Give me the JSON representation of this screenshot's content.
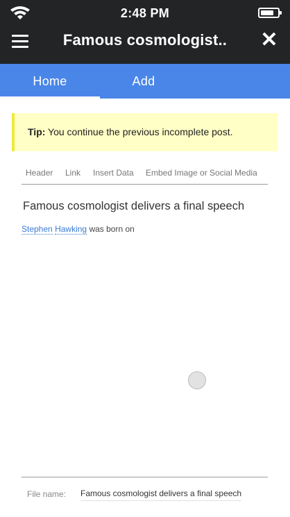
{
  "status_bar": {
    "time": "2:48 PM",
    "icons": [
      "wifi-icon",
      "battery-icon"
    ]
  },
  "app_bar": {
    "title": "Famous cosmologist..",
    "menu_icon": "hamburger-menu-icon",
    "close_icon": "close-icon"
  },
  "tabs": [
    {
      "label": "Home",
      "active": true
    },
    {
      "label": "Add",
      "active": false
    }
  ],
  "tip": {
    "label": "Tip:",
    "text": " You continue the previous incomplete post."
  },
  "editor_toolbar": {
    "items": [
      "Header",
      "Link",
      "Insert Data",
      "Embed Image or Social Media"
    ]
  },
  "post": {
    "headline": "Famous cosmologist delivers a final speech",
    "link1": "Stephen",
    "link2": "Hawking",
    "text": "was born on"
  },
  "footer": {
    "file_name_label": "File name:",
    "file_name_value": "Famous cosmologist delivers a final speech"
  },
  "colors": {
    "status_bar": "#222426",
    "tab_bar": "#4a86e8",
    "tip_background": "#ffffc6",
    "tip_border": "#f0ea3a",
    "link": "#3a7bd5"
  }
}
